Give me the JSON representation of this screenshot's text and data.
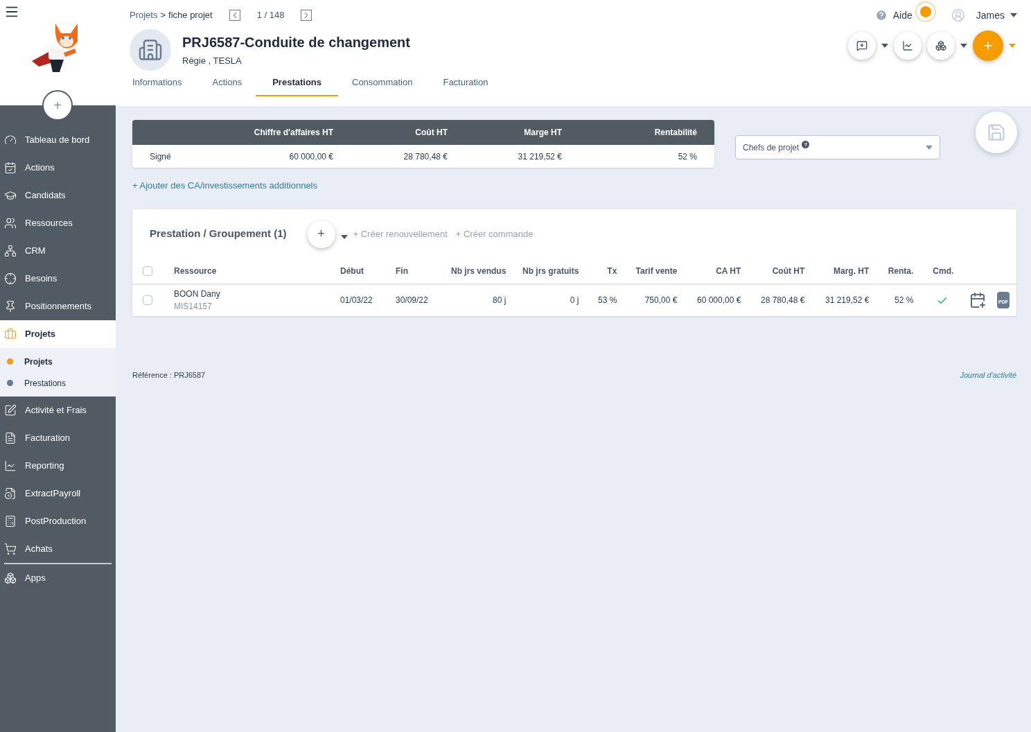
{
  "sidebar": {
    "items": [
      {
        "label": "Tableau de bord",
        "selected": false
      },
      {
        "label": "Actions",
        "selected": false
      },
      {
        "label": "Candidats",
        "selected": false
      },
      {
        "label": "Ressources",
        "selected": false
      },
      {
        "label": "CRM",
        "selected": false
      },
      {
        "label": "Besoins",
        "selected": false
      },
      {
        "label": "Positionnements",
        "selected": false
      },
      {
        "label": "Projets",
        "selected": true,
        "children": [
          {
            "label": "Projets",
            "selected": true
          },
          {
            "label": "Prestations",
            "selected": false
          }
        ]
      },
      {
        "label": "Activité et Frais",
        "selected": false
      },
      {
        "label": "Facturation",
        "selected": false
      },
      {
        "label": "Reporting",
        "selected": false
      },
      {
        "label": "ExtractPayroll",
        "selected": false
      },
      {
        "label": "PostProduction",
        "selected": false
      },
      {
        "label": "Achats",
        "selected": false
      },
      {
        "label": "Apps",
        "selected": false
      }
    ]
  },
  "breadcrumb": {
    "parent": "Projets",
    "separator": ">",
    "current": "fiche projet",
    "pager": "1 / 148"
  },
  "header": {
    "title": "PRJ6587-Conduite de changement",
    "subtitle": "Régie , TESLA",
    "help": "Aide",
    "user": "James"
  },
  "tabs": [
    {
      "label": "Informations",
      "selected": false
    },
    {
      "label": "Actions",
      "selected": false
    },
    {
      "label": "Prestations",
      "selected": true
    },
    {
      "label": "Consommation",
      "selected": false
    },
    {
      "label": "Facturation",
      "selected": false
    }
  ],
  "summary": {
    "columns": [
      "Chiffre d'affaires HT",
      "Coût HT",
      "Marge HT",
      "Rentabilité"
    ],
    "rows": [
      {
        "label": "Signé",
        "cells": [
          "60 000,00 €",
          "28 780,48 €",
          "31 219,52 €",
          "52 %"
        ]
      }
    ]
  },
  "add_link": "+ Ajouter des CA/investissements additionnels",
  "managers_select": {
    "placeholder": "Chefs de projet",
    "help": "?"
  },
  "prestations": {
    "title": "Prestation / Groupement (1)",
    "add": "+",
    "actions": [
      "+ Créer renouvellement",
      "+ Créer commande"
    ],
    "select_all_checked": false,
    "columns": [
      "Ressource",
      "Début",
      "Fin",
      "Nb jrs vendus",
      "Nb jrs gratuits",
      "Tx",
      "Tarif vente",
      "CA HT",
      "Coût HT",
      "Marg. HT",
      "Renta.",
      "Cmd."
    ],
    "rows": [
      {
        "ref": "MIS14157",
        "cells": [
          "BOON Dany",
          "01/03/22",
          "30/09/22",
          "80 j",
          "0 j",
          "53 %",
          "750,00 €",
          "60 000,00 €",
          "28 780,48 €",
          "31 219,52 €",
          "52 %"
        ],
        "checked": false,
        "ordered": true,
        "pdf": "PDF"
      }
    ]
  },
  "footer": {
    "reference": "Référence : PRJ6587",
    "journal": "Journal d'activité"
  },
  "fab": "+"
}
